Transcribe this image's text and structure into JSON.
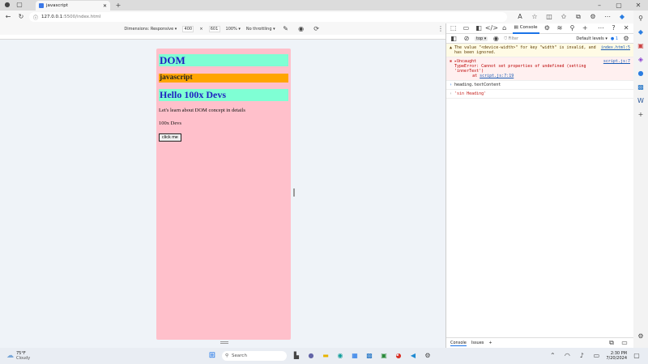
{
  "browser": {
    "tab_title": "javascript",
    "url_host": "127.0.0.1",
    "url_path": ":5500/index.html"
  },
  "device_toolbar": {
    "dimensions_label": "Dimensions: Responsive",
    "width": "400",
    "height": "601",
    "zoom": "100%",
    "throttling": "No throttling"
  },
  "page": {
    "h1": "DOM",
    "h2": "javascript",
    "h3": "Hello 100x Devs",
    "p1": "Let's learn about DOM concept in details",
    "p2": "100x Devs",
    "button": "click me"
  },
  "devtools": {
    "active_tab": "Console",
    "context": "top",
    "filter_placeholder": "Filter",
    "levels": "Default levels",
    "issues_count": "1",
    "messages": [
      {
        "type": "warning",
        "text": "The value \"<device-width>\" for key \"width\" is invalid, and has been ignored.",
        "source": "index.html:5"
      },
      {
        "type": "error",
        "text": "▸Uncaught\nTypeError: Cannot set properties of undefined (setting 'innerText')",
        "at": "at ",
        "at_link": "script.js:7:19",
        "source": "script.js:7"
      },
      {
        "type": "expression",
        "text": "heading.textContent"
      },
      {
        "type": "result",
        "text": "'sin Heading'"
      }
    ],
    "drawer_tabs": [
      "Console",
      "Issues"
    ]
  },
  "taskbar": {
    "temperature": "75°F",
    "weather": "Cloudy",
    "search_placeholder": "Search",
    "time": "2:30 PM",
    "date": "7/20/2024"
  }
}
